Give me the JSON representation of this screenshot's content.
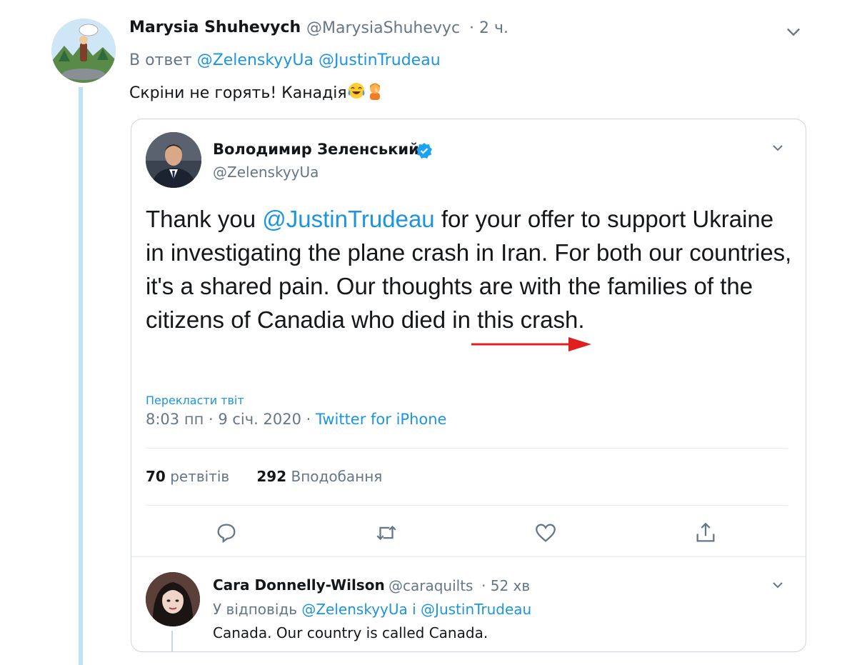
{
  "outer_tweet": {
    "author_name": "Marysia Shuhevych",
    "author_handle": "@MarysiaShuhevyc",
    "time": "· 2 ч.",
    "reply_prefix": "В ответ",
    "reply_mentions": [
      "@ZelenskyyUa",
      "@JustinTrudeau"
    ],
    "text": "Скріни не горять! Канадія",
    "emojis": [
      "face-with-tears-of-joy-icon",
      "person-facepalming-icon"
    ]
  },
  "embedded_tweet": {
    "author_name": "Володимир Зеленський",
    "author_handle": "@ZelenskyyUa",
    "body_prefix": "Thank you ",
    "body_mention": "@JustinTrudeau",
    "body_rest": " for your offer to support Ukraine in investigating the plane crash in Iran. For both our countries, it's a shared pain. Our thoughts are with the families of the citizens of Canadia who died in this crash.",
    "translate_label": "Перекласти твіт",
    "timestamp": "8:03 пп · 9 січ. 2020 · ",
    "source": "Twitter for iPhone",
    "retweets_count": "70",
    "retweets_label": "ретвітів",
    "likes_count": "292",
    "likes_label": "Вподобання",
    "annotation_color": "#e02020"
  },
  "nested_reply": {
    "author_name": "Cara Donnelly-Wilson",
    "author_handle": "@caraquilts",
    "time": "· 52 хв",
    "reply_prefix": "У відповідь",
    "reply_mention_1": "@ZelenskyyUa",
    "reply_joiner": "і",
    "reply_mention_2": "@JustinTrudeau",
    "text": "Canada. Our country is called Canada."
  },
  "colors": {
    "link": "#1b95e0",
    "muted": "#657786",
    "thread_line": "#bfe0f5",
    "verified": "#1da1f2"
  }
}
